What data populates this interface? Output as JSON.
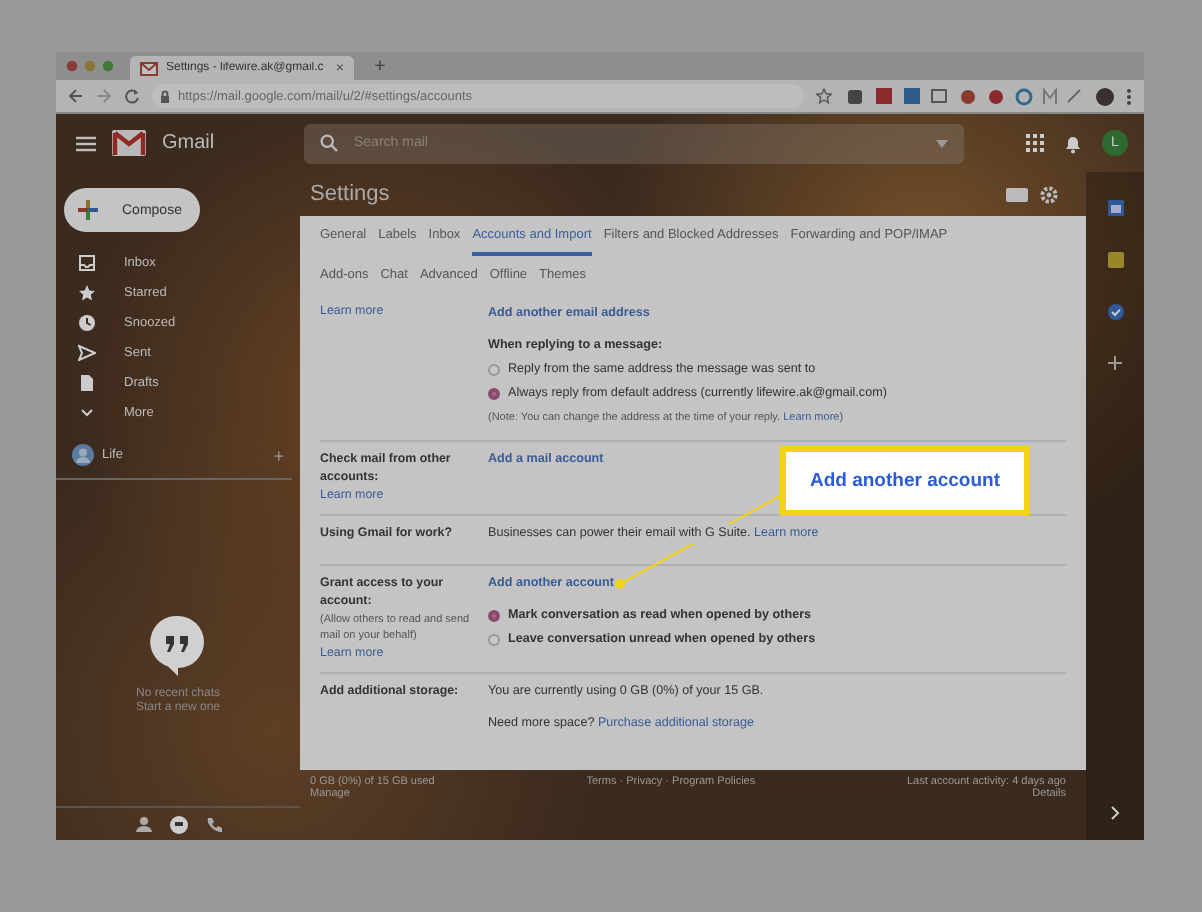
{
  "browser": {
    "tab": {
      "title": "Settings - lifewire.ak@gmail.c",
      "close": "×"
    },
    "new_tab": "+",
    "url": "https://mail.google.com/mail/u/2/#settings/accounts"
  },
  "gmail": {
    "logo": "Gmail",
    "search": {
      "placeholder": "Search mail"
    },
    "avatar": "L",
    "compose": "Compose",
    "nav": [
      {
        "label": "Inbox",
        "kind": "inbox"
      },
      {
        "label": "Starred",
        "kind": "star"
      },
      {
        "label": "Snoozed",
        "kind": "clock"
      },
      {
        "label": "Sent",
        "kind": "sent"
      },
      {
        "label": "Drafts",
        "kind": "draft"
      },
      {
        "label": "More",
        "kind": "more"
      }
    ],
    "account": {
      "name": "Life",
      "add": "+"
    },
    "hangouts": [
      "No recent chats",
      "Start a new one"
    ]
  },
  "settings": {
    "title": "Settings",
    "tabs": [
      [
        {
          "label": "General",
          "selected": false
        },
        {
          "label": "Labels",
          "selected": false
        },
        {
          "label": "Inbox",
          "selected": false
        },
        {
          "label": "Accounts and Import",
          "selected": true
        },
        {
          "label": "Filters and Blocked Addresses",
          "selected": false
        },
        {
          "label": "Forwarding and POP/IMAP",
          "selected": false
        }
      ],
      [
        {
          "label": "Add-ons",
          "selected": false
        },
        {
          "label": "Chat",
          "selected": false
        },
        {
          "label": "Advanced",
          "selected": false
        },
        {
          "label": "Offline",
          "selected": false
        },
        {
          "label": "Themes",
          "selected": false
        }
      ]
    ],
    "rows": [
      {
        "link": "Learn more",
        "items": [
          {
            "kind": "link",
            "text": "Add another email address"
          },
          {
            "kind": "heading",
            "text": "When replying to a message:"
          },
          {
            "kind": "radio",
            "text": "Reply from the same address the message was sent to",
            "selected": false
          },
          {
            "kind": "radio",
            "text": "Always reply from default address (currently lifewire.ak@gmail.com)",
            "selected": true
          },
          {
            "kind": "note",
            "text": "(Note: You can change the address at the time of your reply.",
            "link": "Learn more",
            "after": ")"
          }
        ]
      },
      {
        "label": "Check mail from other accounts:",
        "link": "Learn more",
        "items": [
          {
            "kind": "link",
            "text": "Add a mail account"
          }
        ]
      },
      {
        "label": "Using Gmail for work?",
        "items": [
          {
            "kind": "text",
            "text": "Businesses can power their email with G Suite.",
            "link": "Learn more"
          }
        ]
      },
      {
        "label": "Grant access to your account:",
        "hint": "(Allow others to read and send mail on your behalf)",
        "link": "Learn more",
        "items": [
          {
            "kind": "link",
            "text": "Add another account",
            "pointer": true
          },
          {
            "kind": "radio",
            "text": "Mark conversation as read when opened by others",
            "selected": true
          },
          {
            "kind": "radio",
            "text": "Leave conversation unread when opened by others",
            "selected": false
          }
        ]
      },
      {
        "label": "Add additional storage:",
        "items": [
          {
            "kind": "text",
            "text": "You are currently using 0 GB (0%) of your 15 GB."
          },
          {
            "kind": "text",
            "text": "Need more space?",
            "link": "Purchase additional storage"
          }
        ]
      }
    ]
  },
  "footer": [
    {
      "text": "0 GB (0%) of 15 GB used",
      "link": "Manage"
    },
    {
      "text": "Terms · Privacy · Program Policies"
    },
    {
      "text": "Last account activity: 4 days ago",
      "link": "Details"
    }
  ],
  "callout": {
    "text": "Add another account"
  }
}
